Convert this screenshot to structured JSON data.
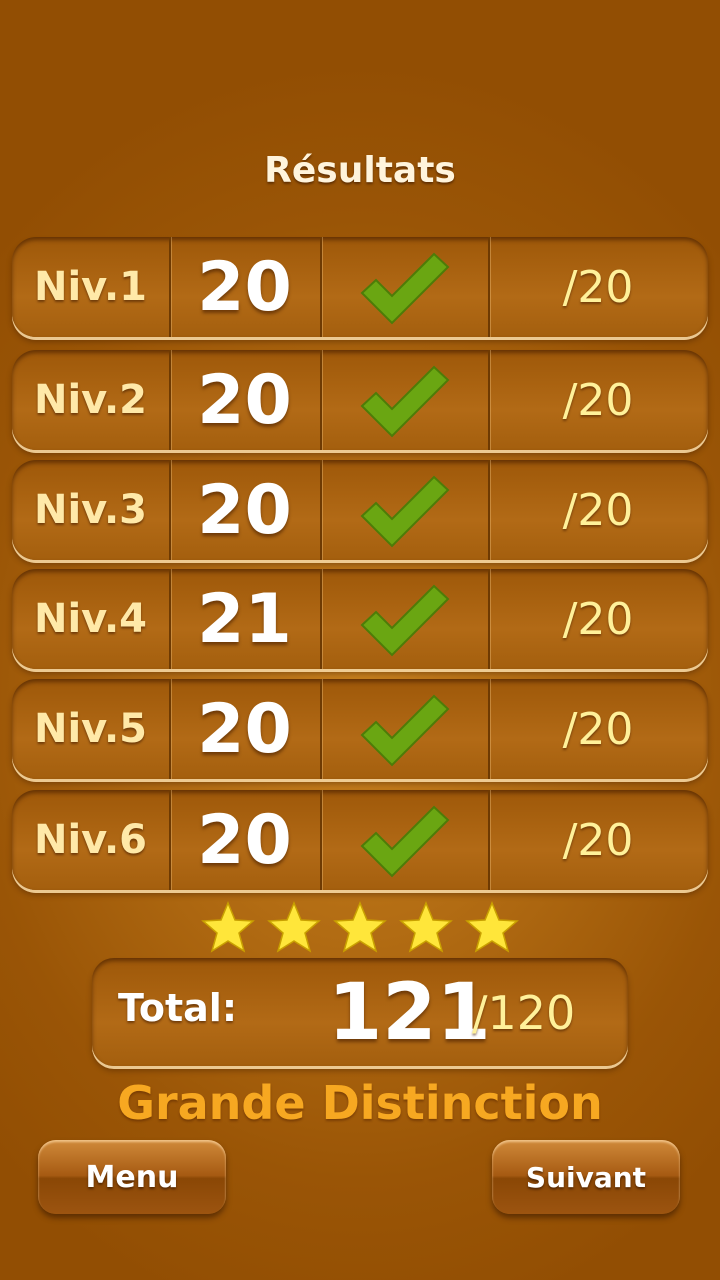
{
  "title": "Résultats",
  "rows": [
    {
      "level": "Niv.1",
      "score": "20",
      "max": "/20",
      "passed": true
    },
    {
      "level": "Niv.2",
      "score": "20",
      "max": "/20",
      "passed": true
    },
    {
      "level": "Niv.3",
      "score": "20",
      "max": "/20",
      "passed": true
    },
    {
      "level": "Niv.4",
      "score": "21",
      "max": "/20",
      "passed": true
    },
    {
      "level": "Niv.5",
      "score": "20",
      "max": "/20",
      "passed": true
    },
    {
      "level": "Niv.6",
      "score": "20",
      "max": "/20",
      "passed": true
    }
  ],
  "check_icon": "check-icon",
  "stars": {
    "count": 5,
    "filled": 5,
    "icon": "star-icon",
    "color": "#ffe63a"
  },
  "total": {
    "label": "Total:",
    "value": "121",
    "max": "/120"
  },
  "distinction": "Grande Distinction",
  "buttons": {
    "menu": "Menu",
    "next": "Suivant"
  },
  "colors": {
    "check": "#6aa612",
    "accent": "#f7a821",
    "max_text": "#fff19a",
    "level_text": "#ffe9a8"
  }
}
